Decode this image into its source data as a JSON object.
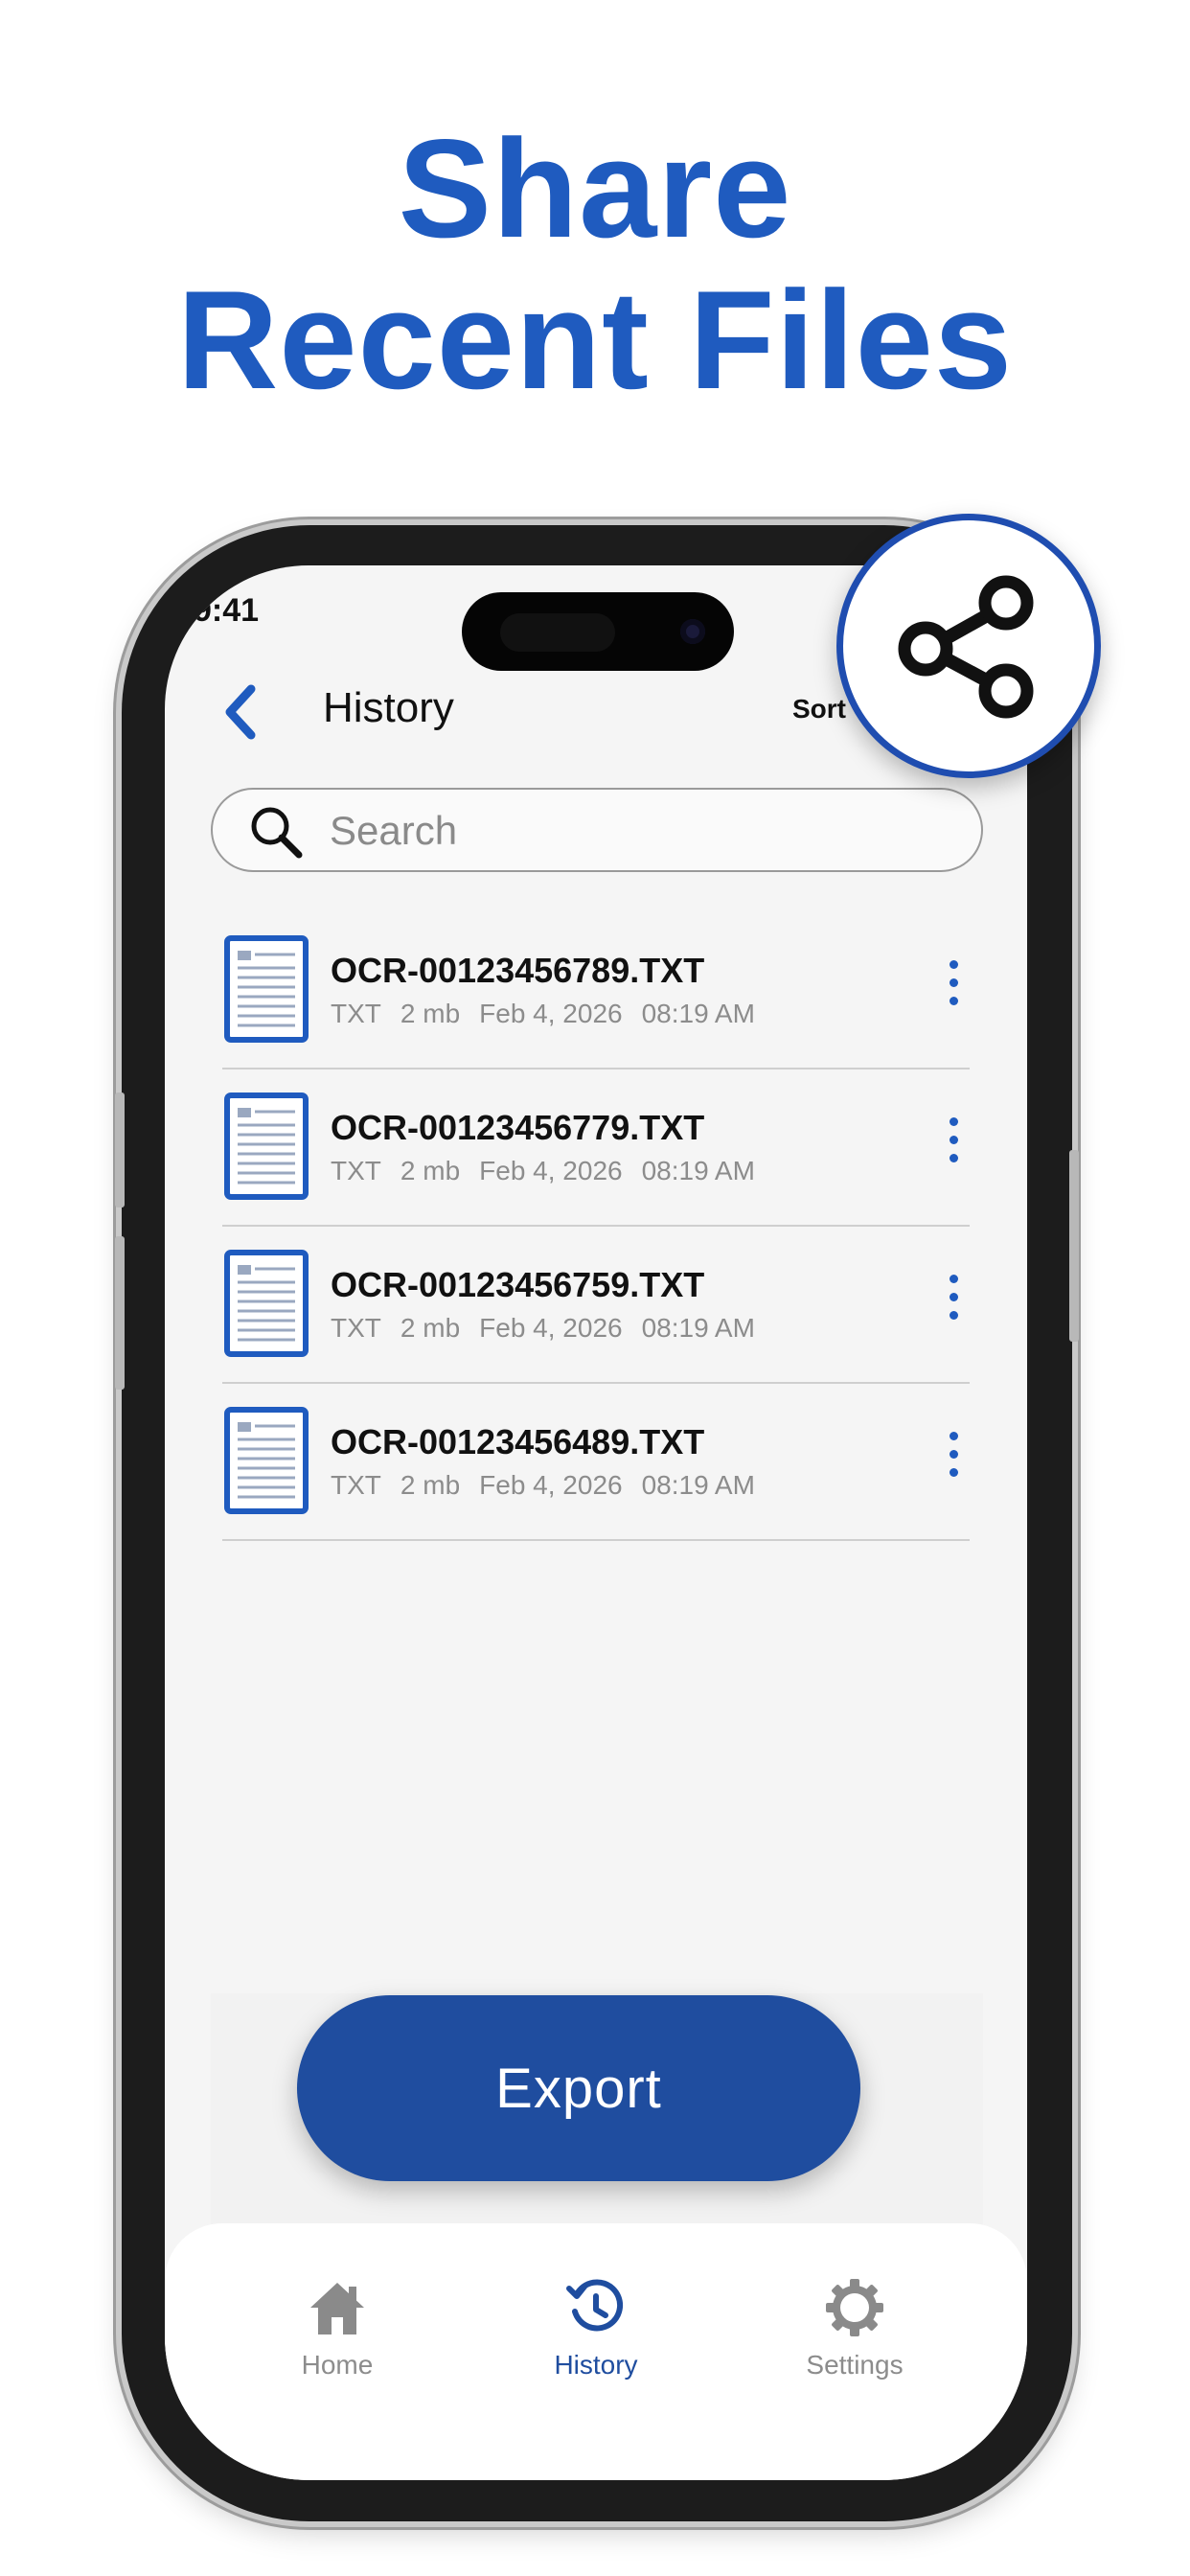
{
  "headline": {
    "line1": "Share",
    "line2": "Recent Files"
  },
  "status_bar": {
    "time": "9:41"
  },
  "nav": {
    "title": "History",
    "sort_label": "Sort"
  },
  "search": {
    "placeholder": "Search",
    "value": ""
  },
  "files": [
    {
      "name": "OCR-00123456789.TXT",
      "type": "TXT",
      "size": "2 mb",
      "date": "Feb 4, 2026",
      "time": "08:19 AM"
    },
    {
      "name": "OCR-00123456779.TXT",
      "type": "TXT",
      "size": "2 mb",
      "date": "Feb 4, 2026",
      "time": "08:19 AM"
    },
    {
      "name": "OCR-00123456759.TXT",
      "type": "TXT",
      "size": "2 mb",
      "date": "Feb 4, 2026",
      "time": "08:19 AM"
    },
    {
      "name": "OCR-00123456489.TXT",
      "type": "TXT",
      "size": "2 mb",
      "date": "Feb 4, 2026",
      "time": "08:19 AM"
    }
  ],
  "export_label": "Export",
  "tabs": [
    {
      "label": "Home",
      "icon": "home-icon",
      "active": false
    },
    {
      "label": "History",
      "icon": "history-icon",
      "active": true
    },
    {
      "label": "Settings",
      "icon": "gear-icon",
      "active": false
    }
  ],
  "badge_icon": "share-icon",
  "colors": {
    "accent": "#1f5bbf",
    "button": "#1f4d9f",
    "inactive": "#8c8c8c"
  }
}
